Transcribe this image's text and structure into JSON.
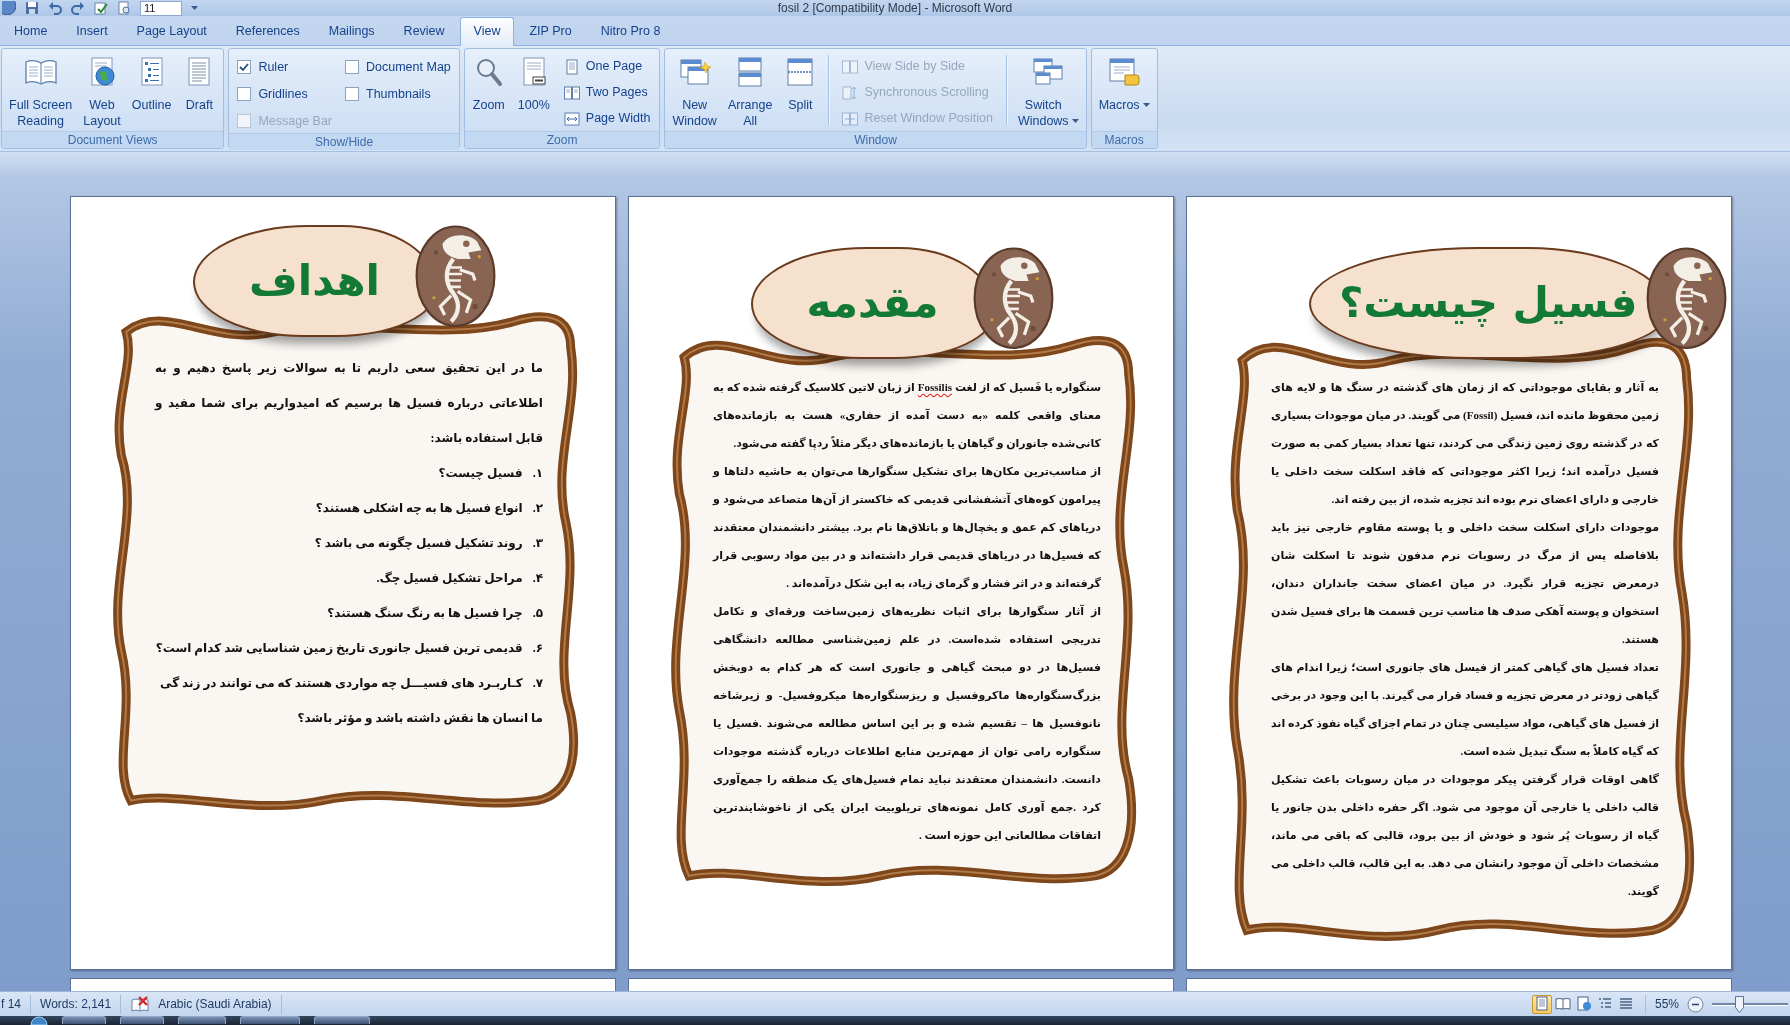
{
  "window": {
    "title": "fosil 2 [Compatibility Mode] - Microsoft Word"
  },
  "quick_access": {
    "font_size": "11"
  },
  "tabs": [
    {
      "label": "Nitro Pro 8",
      "selected": false
    },
    {
      "label": "ZIP Pro",
      "selected": false
    },
    {
      "label": "View",
      "selected": true
    },
    {
      "label": "Review",
      "selected": false
    },
    {
      "label": "Mailings",
      "selected": false
    },
    {
      "label": "References",
      "selected": false
    },
    {
      "label": "Page Layout",
      "selected": false
    },
    {
      "label": "Insert",
      "selected": false
    },
    {
      "label": "Home",
      "selected": false
    }
  ],
  "ribbon": {
    "groups": [
      {
        "title": "Macros",
        "items": [
          {
            "kind": "large",
            "label": "Macros",
            "disabled": false,
            "dropdown": true
          }
        ]
      },
      {
        "title": "Window",
        "items": [
          {
            "kind": "large",
            "label": "Switch\nWindows",
            "disabled": false,
            "dropdown": true
          },
          {
            "kind": "separator"
          },
          {
            "kind": "column",
            "items": [
              {
                "kind": "small",
                "label": "View Side by Side",
                "disabled": true
              },
              {
                "kind": "small",
                "label": "Synchronous Scrolling",
                "disabled": true
              },
              {
                "kind": "small",
                "label": "Reset Window Position",
                "disabled": true
              }
            ]
          },
          {
            "kind": "separator"
          },
          {
            "kind": "large",
            "label": "Split",
            "disabled": false,
            "dropdown": false
          },
          {
            "kind": "large",
            "label": "Arrange\nAll",
            "disabled": false,
            "dropdown": false
          },
          {
            "kind": "large",
            "label": "New\nWindow",
            "disabled": false,
            "dropdown": false
          }
        ]
      },
      {
        "title": "Zoom",
        "items": [
          {
            "kind": "column",
            "items": [
              {
                "kind": "small",
                "label": "One Page",
                "disabled": false
              },
              {
                "kind": "small",
                "label": "Two Pages",
                "disabled": false
              },
              {
                "kind": "small",
                "label": "Page Width",
                "disabled": false
              }
            ]
          },
          {
            "kind": "large",
            "label": "100%",
            "disabled": false,
            "dropdown": false
          },
          {
            "kind": "large",
            "label": "Zoom",
            "disabled": false,
            "dropdown": false
          }
        ]
      },
      {
        "title": "Show/Hide",
        "items": [
          {
            "kind": "column",
            "items": [
              {
                "kind": "check",
                "label": "Document Map",
                "checked": false,
                "disabled": false
              },
              {
                "kind": "check",
                "label": "Thumbnails",
                "checked": false,
                "disabled": false
              }
            ]
          },
          {
            "kind": "column",
            "items": [
              {
                "kind": "check",
                "label": "Ruler",
                "checked": true,
                "disabled": false
              },
              {
                "kind": "check",
                "label": "Gridlines",
                "checked": false,
                "disabled": false
              },
              {
                "kind": "check",
                "label": "Message Bar",
                "checked": false,
                "disabled": true
              }
            ]
          }
        ]
      },
      {
        "title": "Document Views",
        "items": [
          {
            "kind": "large",
            "label": "Draft",
            "disabled": false,
            "dropdown": false
          },
          {
            "kind": "large",
            "label": "Outline",
            "disabled": false,
            "dropdown": false
          },
          {
            "kind": "large",
            "label": "Web\nLayout",
            "disabled": false,
            "dropdown": false
          },
          {
            "kind": "large",
            "label": "Full Screen\nReading",
            "disabled": false,
            "dropdown": false
          }
        ]
      }
    ]
  },
  "pages": [
    {
      "title": "فسیل چیست؟",
      "blocks": [
        {
          "kind": "paragraph",
          "segments": [
            {
              "text": "به آثار و بقایای موجوداتی که از زمان های گذشته در سنگ ها و لایه های زمین محفوظ مانده اند، فسیل (Fossil) می گویند. در میان موجودات بسیاری که در گذشته روی زمین زندگی می کردند، تنها تعداد بسیار کمی به صورت فسیل درآمده اند؛ زیرا اکثر موجوداتی که فاقد اسکلت سخت داخلی یا خارجی و دارای اعضای نرم بوده اند تجزیه شده، از بین رفته اند.",
              "misspelled": false
            }
          ]
        },
        {
          "kind": "paragraph",
          "segments": [
            {
              "text": "موجودات دارای اسکلت سخت داخلی و یا پوسته مقاوم خارجی نیز باید بلافاصله پس از مرگ در رسوبات نرم مدفون شوند تا اسکلت شان درمعرض تجزیه قرار نگیرد. در میان اعضای سخت جانداران دندان، استخوان و پوسته آهکی صدف ها مناسب ترین قسمت ها برای فسیل شدن هستند.",
              "misspelled": false
            }
          ]
        },
        {
          "kind": "paragraph",
          "segments": [
            {
              "text": "تعداد فسیل های گیاهی کمتر از فیسل های جانوری است؛ زیرا اندام های گیاهی زودتر در معرض تجزیه و فساد قرار می گیرند. با این وجود در برخی از فسیل های گیاهی، مواد سیلیسی چنان در تمام اجزای گیاه نفوذ کرده اند که گیاه کاملاً به سنگ تبدیل شده است.",
              "misspelled": false
            }
          ]
        },
        {
          "kind": "paragraph",
          "segments": [
            {
              "text": "گاهی اوقات قرار گرفتن پیکر موجودات در میان رسوبات باعث تشکیل قالب داخلی یا خارجی آن موجود می شود. اگر حفره داخلی بدن جانور یا گیاه از رسوبات پُر شود و خودش از بین برود، قالبی که باقی می ماند، مشخصات داخلی آن موجود رانشان می دهد. به این قالب، قالب داخلی می گویند.",
              "misspelled": false
            }
          ]
        }
      ]
    },
    {
      "title": "مقدمه",
      "blocks": [
        {
          "kind": "paragraph",
          "segments": [
            {
              "text": "سنگواره یا فَسیل که از لغت ",
              "misspelled": false
            },
            {
              "text": "Fossilis",
              "misspelled": true
            },
            {
              "text": " از زبان لاتین کلاسیک گرفته شده که به معنای واقعی کلمه «به دست آمده از حفاری» هست به بازمانده‌های کانی‌شده جانوران و گیاهان یا بازمانده‌های دیگر مثلاً ردپا گفته می‌شود.",
              "misspelled": false
            }
          ]
        },
        {
          "kind": "paragraph",
          "segments": [
            {
              "text": "از مناسب‌ترین مکان‌ها برای تشکیل سنگوارها می‌توان به حاشیه دلتاها و پیرامون کوه‌های آتشفشانی قدیمی که خاکستر از آن‌ها متصاعد می‌شود و دریاهای کم عمق و یخچال‌ها و باتلاق‌ها نام برد. بیشتر دانشمندان معتقدند که فسیل‌ها در دریاهای قدیمی قرار داشته‌اند و در بین مواد رسوبی قرار گرفته‌اند و در اثر فشار و گرمای زیاد، به این شکل درآمده‌اند .",
              "misspelled": false
            }
          ]
        },
        {
          "kind": "paragraph",
          "segments": [
            {
              "text": "از آثار سنگوارها برای اثبات نظریه‌های زمین‌ساخت ورقه‌ای و تکامل تدریجی استفاده شده‌است. در علم زمین‌شناسی مطالعه دانشگاهی فسیل‌ها در دو مبحث گیاهی و جانوری است که هر کدام به دوبخش بزرگ‌سنگواره‌ها ماکروفسیل و ریزسنگواره‌ها میکروفسیل- و زیرشاخه نانوفسیل ها – تقسیم شده و بر این اساس مطالعه می‌شوند .فسیل یا سنگواره رامی توان از مهم‌ترین منابع اطلاعات درباره گذشته موجودات دانست. دانشمندان معتقدند نباید تمام فسیل‌های یک منطقه را جمع‌آوری کرد .جمع آوری کامل نمونه‌های تریلوبیت ایران یکی از ناخوشایندترین اتفاقات مطالعاتی این حوزه است .",
              "misspelled": false
            }
          ]
        }
      ]
    },
    {
      "title": "اهداف",
      "blocks": [
        {
          "kind": "paragraph",
          "segments": [
            {
              "text": "ما در این تحقیق سعی داریم تا به سوالات زیر پاسخ دهیم و به اطلاعاتی درباره فسیل ها برسیم که امیدواریم برای شما مفید و قابل استفاده باشد:",
              "misspelled": false
            }
          ]
        },
        {
          "kind": "list_item",
          "number": "۱.",
          "text": "فسیل چیست؟"
        },
        {
          "kind": "list_item",
          "number": "۲.",
          "text": "انواع فسیل ها به چه اشکلی هستند؟"
        },
        {
          "kind": "list_item",
          "number": "۳.",
          "text": "روند تشکیل فسیل چگونه می باشد ؟"
        },
        {
          "kind": "list_item",
          "number": "۴.",
          "text": "مراحل تشکیل فسیل چگ."
        },
        {
          "kind": "list_item",
          "number": "۵.",
          "text": "چرا فسیل ها به رنگ سنگ هستند؟"
        },
        {
          "kind": "list_item",
          "number": "۶.",
          "text": "قدیمی ترین فسیل جانوری تاریخ زمین شناسایی شد کدام است؟"
        },
        {
          "kind": "list_item",
          "number": "۷.",
          "text": "کـاربـرد های فسیـــل چه مواردی هستند که می توانند در زند گی ما انسان ها نقش داشته باشد و مؤثر باشد؟"
        }
      ]
    }
  ],
  "status_bar": {
    "page": "f 14",
    "words": "Words: 2,141",
    "language": "Arabic (Saudi Arabia)",
    "views": [
      {
        "selected": false
      },
      {
        "selected": false
      },
      {
        "selected": false
      },
      {
        "selected": false
      },
      {
        "selected": true
      }
    ],
    "zoom": "55%",
    "zoom_slider": {
      "level": 0.35
    }
  }
}
